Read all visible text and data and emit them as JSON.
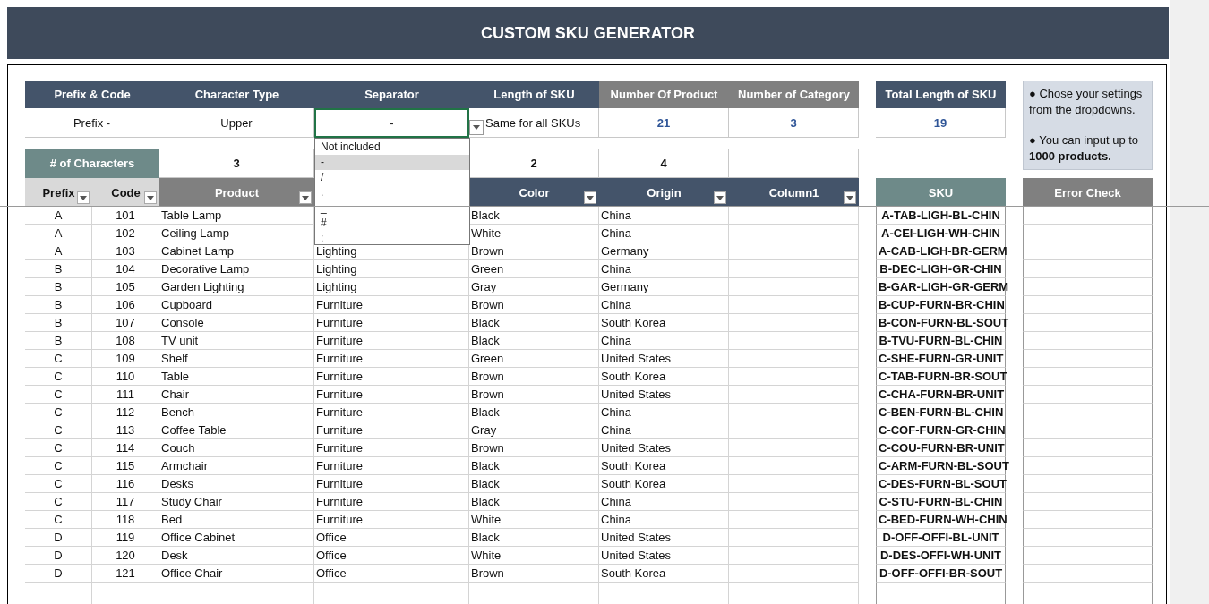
{
  "title": "CUSTOM SKU GENERATOR",
  "settings": [
    {
      "label": "Prefix & Code",
      "value": "Prefix -",
      "kind": "dark",
      "focused": false
    },
    {
      "label": "Character Type",
      "value": "Upper",
      "kind": "dark",
      "focused": false
    },
    {
      "label": "Separator",
      "value": "-",
      "kind": "dark",
      "focused": true
    },
    {
      "label": "Length of SKU",
      "value": "Same for all SKUs",
      "kind": "dark",
      "focused": false
    },
    {
      "label": "Number Of Product",
      "value": "21",
      "kind": "grey",
      "focused": false
    },
    {
      "label": "Number of Category",
      "value": "3",
      "kind": "grey",
      "focused": false
    }
  ],
  "total": {
    "label": "Total Length of SKU",
    "value": "19"
  },
  "note": {
    "lines": [
      "● Chose your settings from the dropdowns.",
      "● You can input up to **1000 products.**"
    ]
  },
  "separator_dropdown": {
    "options": [
      {
        "label": "Not included",
        "selected": false
      },
      {
        "label": "-",
        "selected": true
      },
      {
        "label": "/",
        "selected": false
      },
      {
        "label": ".",
        "selected": false
      },
      {
        "label": "_",
        "selected": false
      },
      {
        "label": "#",
        "selected": false
      },
      {
        "label": ":",
        "selected": false
      }
    ]
  },
  "characters": {
    "label": "# of Characters",
    "values": [
      "3",
      "2",
      "4"
    ]
  },
  "table": {
    "columns": [
      {
        "label": "Prefix",
        "kind": "light"
      },
      {
        "label": "Code",
        "kind": "light"
      },
      {
        "label": "Product",
        "kind": "grey"
      },
      {
        "label": "Color",
        "kind": "dark"
      },
      {
        "label": "Origin",
        "kind": "dark"
      },
      {
        "label": "Column1",
        "kind": "dark"
      }
    ],
    "sku_header": "SKU",
    "error_header": "Error Check",
    "rows": [
      {
        "prefix": "A",
        "code": "101",
        "product": "Table Lamp",
        "shade": "Black",
        "origin": "China",
        "sku": "A-TAB-LIGH-BL-CHIN"
      },
      {
        "prefix": "A",
        "code": "102",
        "product": "Ceiling Lamp",
        "shade": "White",
        "origin": "China",
        "sku": "A-CEI-LIGH-WH-CHIN"
      },
      {
        "prefix": "A",
        "code": "103",
        "product": "Cabinet Lamp",
        "category": "Lighting",
        "shade": "Brown",
        "origin": "Germany",
        "sku": "A-CAB-LIGH-BR-GERM"
      },
      {
        "prefix": "B",
        "code": "104",
        "product": "Decorative Lamp",
        "category": "Lighting",
        "shade": "Green",
        "origin": "China",
        "sku": "B-DEC-LIGH-GR-CHIN"
      },
      {
        "prefix": "B",
        "code": "105",
        "product": "Garden Lighting",
        "category": "Lighting",
        "shade": "Gray",
        "origin": "Germany",
        "sku": "B-GAR-LIGH-GR-GERM"
      },
      {
        "prefix": "B",
        "code": "106",
        "product": "Cupboard",
        "category": "Furniture",
        "shade": "Brown",
        "origin": "China",
        "sku": "B-CUP-FURN-BR-CHIN"
      },
      {
        "prefix": "B",
        "code": "107",
        "product": "Console",
        "category": "Furniture",
        "shade": "Black",
        "origin": "South Korea",
        "sku": "B-CON-FURN-BL-SOUT"
      },
      {
        "prefix": "B",
        "code": "108",
        "product": "TV unit",
        "category": "Furniture",
        "shade": "Black",
        "origin": "China",
        "sku": "B-TVU-FURN-BL-CHIN"
      },
      {
        "prefix": "C",
        "code": "109",
        "product": "Shelf",
        "category": "Furniture",
        "shade": "Green",
        "origin": "United States",
        "sku": "C-SHE-FURN-GR-UNIT"
      },
      {
        "prefix": "C",
        "code": "110",
        "product": "Table",
        "category": "Furniture",
        "shade": "Brown",
        "origin": "South Korea",
        "sku": "C-TAB-FURN-BR-SOUT"
      },
      {
        "prefix": "C",
        "code": "111",
        "product": "Chair",
        "category": "Furniture",
        "shade": "Brown",
        "origin": "United States",
        "sku": "C-CHA-FURN-BR-UNIT"
      },
      {
        "prefix": "C",
        "code": "112",
        "product": "Bench",
        "category": "Furniture",
        "shade": "Black",
        "origin": "China",
        "sku": "C-BEN-FURN-BL-CHIN"
      },
      {
        "prefix": "C",
        "code": "113",
        "product": "Coffee Table",
        "category": "Furniture",
        "shade": "Gray",
        "origin": "China",
        "sku": "C-COF-FURN-GR-CHIN"
      },
      {
        "prefix": "C",
        "code": "114",
        "product": "Couch",
        "category": "Furniture",
        "shade": "Brown",
        "origin": "United States",
        "sku": "C-COU-FURN-BR-UNIT"
      },
      {
        "prefix": "C",
        "code": "115",
        "product": "Armchair",
        "category": "Furniture",
        "shade": "Black",
        "origin": "South Korea",
        "sku": "C-ARM-FURN-BL-SOUT"
      },
      {
        "prefix": "C",
        "code": "116",
        "product": "Desks",
        "category": "Furniture",
        "shade": "Black",
        "origin": "South Korea",
        "sku": "C-DES-FURN-BL-SOUT"
      },
      {
        "prefix": "C",
        "code": "117",
        "product": "Study Chair",
        "category": "Furniture",
        "shade": "Black",
        "origin": "China",
        "sku": "C-STU-FURN-BL-CHIN"
      },
      {
        "prefix": "C",
        "code": "118",
        "product": "Bed",
        "category": "Furniture",
        "shade": "White",
        "origin": "China",
        "sku": "C-BED-FURN-WH-CHIN"
      },
      {
        "prefix": "D",
        "code": "119",
        "product": "Office Cabinet",
        "category": "Office",
        "shade": "Black",
        "origin": "United States",
        "sku": "D-OFF-OFFI-BL-UNIT"
      },
      {
        "prefix": "D",
        "code": "120",
        "product": "Desk",
        "category": "Office",
        "shade": "White",
        "origin": "United States",
        "sku": "D-DES-OFFI-WH-UNIT"
      },
      {
        "prefix": "D",
        "code": "121",
        "product": "Office Chair",
        "category": "Office",
        "shade": "Brown",
        "origin": "South Korea",
        "sku": "D-OFF-OFFI-BR-SOUT"
      }
    ]
  }
}
